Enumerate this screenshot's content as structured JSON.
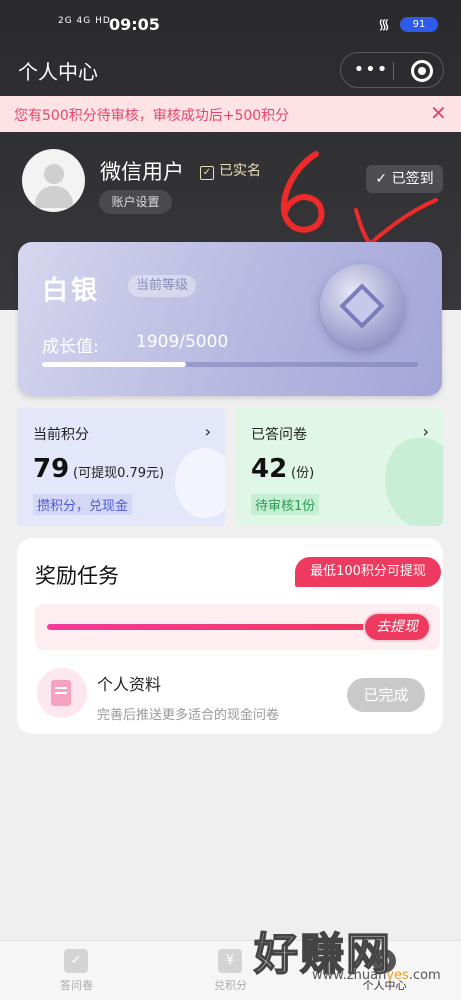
{
  "status_bar": {
    "signal": "2G 4G HD",
    "time": "09:05",
    "battery": "91"
  },
  "nav": {
    "title": "个人中心",
    "more_icon": "more-dots-icon",
    "close_icon": "target-icon"
  },
  "notice": {
    "text": "您有500积分待审核，审核成功后+500积分",
    "close": "✕"
  },
  "user": {
    "name": "微信用户",
    "verified": "已实名",
    "account_settings": "账户设置",
    "signed_in": "已签到"
  },
  "annotation": {
    "number": "6"
  },
  "level": {
    "name": "白银",
    "tag": "当前等级",
    "growth_label": "成长值:",
    "growth_value": "1909/5000",
    "progress": 0.3818
  },
  "points": {
    "label": "当前积分",
    "value": "79",
    "sub": "(可提现0.79元)",
    "pill": "攒积分，兑现金"
  },
  "surveys": {
    "label": "已答问卷",
    "value": "42",
    "sub": "(份)",
    "pill": "待审核1份"
  },
  "tasks": {
    "title": "奖励任务",
    "badge": "最低100积分可提现",
    "withdraw": "去提现",
    "item": {
      "name": "个人资料",
      "desc": "完善后推送更多适合的现金问卷",
      "status": "已完成"
    }
  },
  "tabbar": {
    "tabs": [
      {
        "label": "答问卷",
        "icon": "survey-icon"
      },
      {
        "label": "兑积分",
        "icon": "yen-icon",
        "glyph": "¥"
      },
      {
        "label": "个人中心",
        "icon": "person-icon"
      }
    ]
  },
  "watermark": {
    "text": "好赚网",
    "url_a": "www.zhuan",
    "url_hl": "yes",
    "url_b": ".com"
  },
  "colors": {
    "accent": "#ee3a5f",
    "header": "#2a2a2c"
  }
}
